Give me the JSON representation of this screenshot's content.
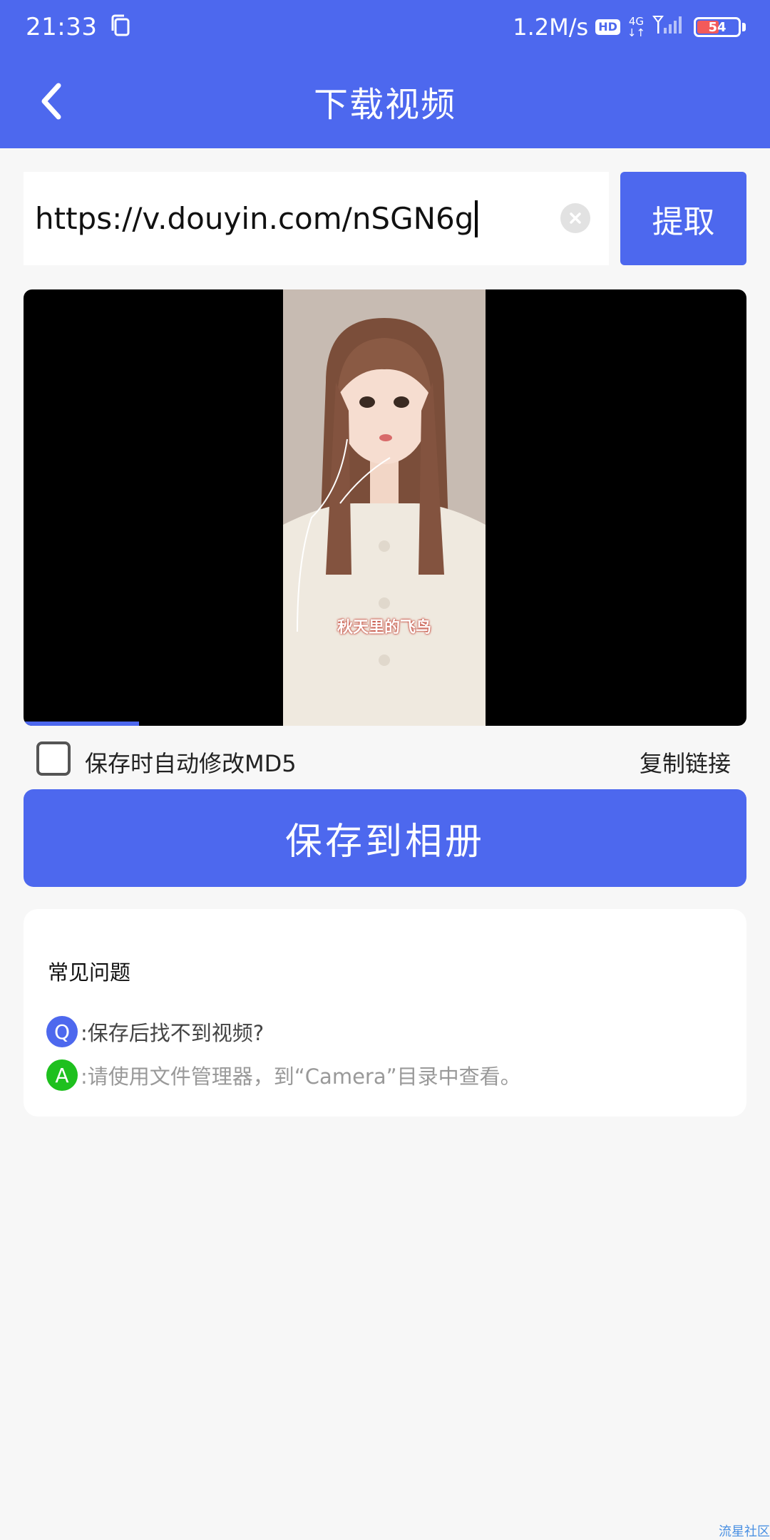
{
  "status": {
    "time": "21:33",
    "net_speed": "1.2M/s",
    "hd": "HD",
    "network": "4G",
    "battery": "54"
  },
  "header": {
    "title": "下载视频"
  },
  "url": {
    "value": "https://v.douyin.com/nSGN6g"
  },
  "buttons": {
    "extract": "提取",
    "save": "保存到相册"
  },
  "video": {
    "caption": "秋天里的飞鸟",
    "progress": 0.16
  },
  "options": {
    "md5_label": "保存时自动修改MD5",
    "copy_link": "复制链接"
  },
  "faq": {
    "title": "常见问题",
    "q_badge": "Q",
    "question": ":保存后找不到视频?",
    "a_badge": "A",
    "answer": ":请使用文件管理器，到“Camera”目录中查看。"
  },
  "watermark": "流星社区",
  "colors": {
    "accent": "#4d68ee",
    "q_badge": "#4d68ee",
    "a_badge": "#1ec01e"
  }
}
